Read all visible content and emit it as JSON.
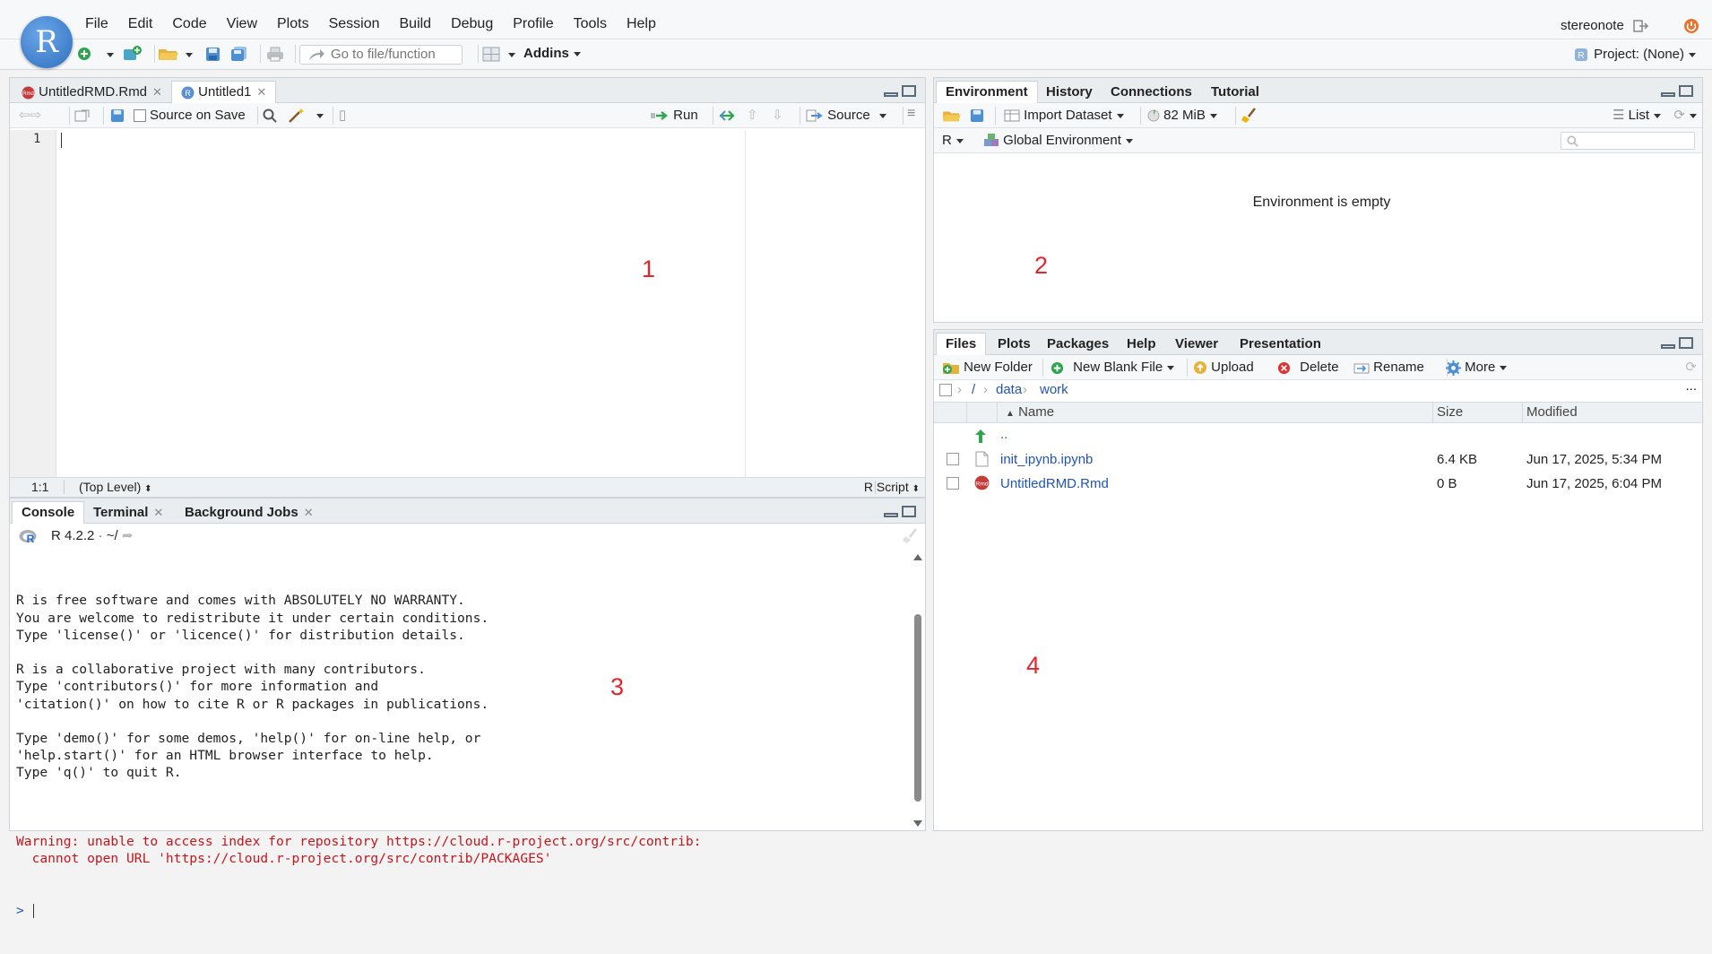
{
  "app": {
    "menu": [
      "File",
      "Edit",
      "Code",
      "View",
      "Plots",
      "Session",
      "Build",
      "Debug",
      "Profile",
      "Tools",
      "Help"
    ],
    "user": "stereonote",
    "goto_placeholder": "Go to file/function",
    "addins_label": "Addins",
    "project_label": "Project: (None)",
    "logo_letter": "R"
  },
  "editor": {
    "tabs": [
      {
        "label": "UntitledRMD.Rmd"
      },
      {
        "label": "Untitled1"
      }
    ],
    "source_on_save": "Source on Save",
    "run_label": "Run",
    "source_label": "Source",
    "line_number": "1",
    "cursor_pos": "1:1",
    "scope": "(Top Level)",
    "file_type": "R Script",
    "annotation": "1"
  },
  "environment": {
    "tabs": [
      "Environment",
      "History",
      "Connections",
      "Tutorial"
    ],
    "import_dataset": "Import Dataset",
    "memory": "82 MiB",
    "view_mode": "List",
    "language": "R",
    "scope": "Global Environment",
    "empty_message": "Environment is empty",
    "annotation": "2"
  },
  "console": {
    "tabs": [
      {
        "label": "Console"
      },
      {
        "label": "Terminal"
      },
      {
        "label": "Background Jobs"
      }
    ],
    "version": "R 4.2.2",
    "path": "~/",
    "output_lines": [
      "R is free software and comes with ABSOLUTELY NO WARRANTY.",
      "You are welcome to redistribute it under certain conditions.",
      "Type 'license()' or 'licence()' for distribution details.",
      "",
      "R is a collaborative project with many contributors.",
      "Type 'contributors()' for more information and",
      "'citation()' on how to cite R or R packages in publications.",
      "",
      "Type 'demo()' for some demos, 'help()' for on-line help, or",
      "'help.start()' for an HTML browser interface to help.",
      "Type 'q()' to quit R."
    ],
    "warning_lines": [
      "Warning: unable to access index for repository https://cloud.r-project.org/src/contrib:",
      "  cannot open URL 'https://cloud.r-project.org/src/contrib/PACKAGES'"
    ],
    "prompt": ">",
    "annotation": "3"
  },
  "files": {
    "tabs": [
      "Files",
      "Plots",
      "Packages",
      "Help",
      "Viewer",
      "Presentation"
    ],
    "new_folder": "New Folder",
    "new_blank_file": "New Blank File",
    "upload": "Upload",
    "delete": "Delete",
    "rename": "Rename",
    "more": "More",
    "breadcrumb": [
      "/",
      "data",
      "work"
    ],
    "ellipsis": "...",
    "columns": {
      "name": "Name",
      "size": "Size",
      "modified": "Modified"
    },
    "parent": "..",
    "rows": [
      {
        "name": "init_ipynb.ipynb",
        "size": "6.4 KB",
        "modified": "Jun 17, 2025, 5:34 PM",
        "icon": "file-icon"
      },
      {
        "name": "UntitledRMD.Rmd",
        "size": "0 B",
        "modified": "Jun 17, 2025, 6:04 PM",
        "icon": "rmd-icon"
      }
    ],
    "annotation": "4"
  },
  "colors": {
    "accent": "#2f6fbf",
    "warning": "#c5161d",
    "annotation": "#e3262d",
    "link": "#2155b0"
  }
}
